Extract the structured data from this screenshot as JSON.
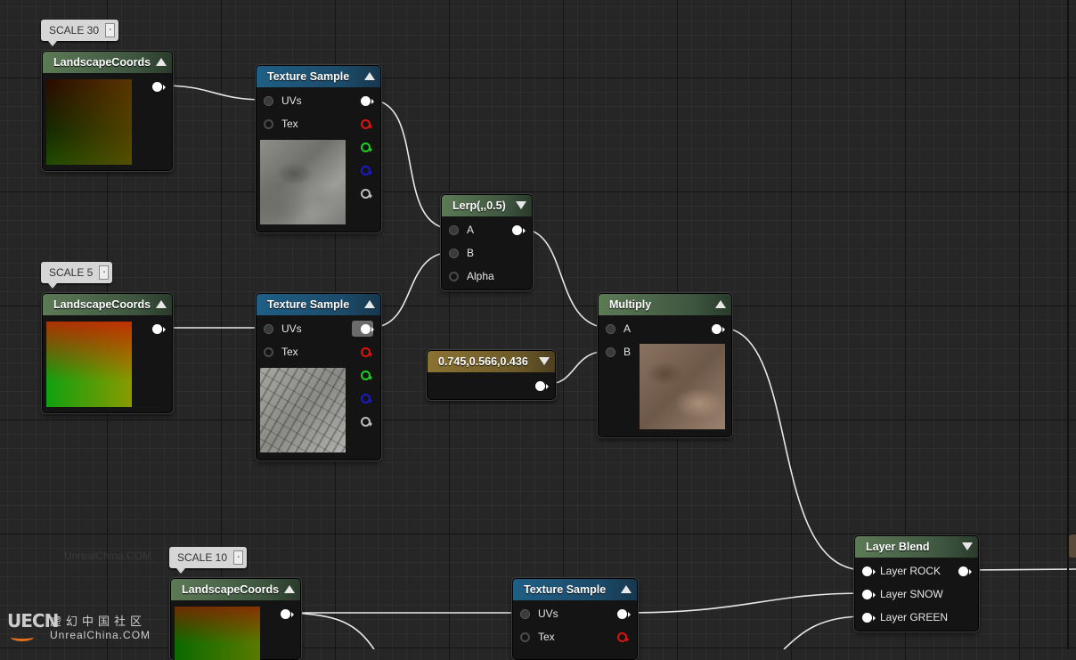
{
  "comments": {
    "scale30": "SCALE 30",
    "scale5": "SCALE 5",
    "scale10": "SCALE 10"
  },
  "nodes": {
    "coords1": {
      "title": "LandscapeCoords"
    },
    "coords2": {
      "title": "LandscapeCoords"
    },
    "coords3": {
      "title": "LandscapeCoords"
    },
    "tex1": {
      "title": "Texture Sample",
      "pins": [
        "UVs",
        "Tex"
      ]
    },
    "tex2": {
      "title": "Texture Sample",
      "pins": [
        "UVs",
        "Tex"
      ]
    },
    "tex3": {
      "title": "Texture Sample",
      "pins": [
        "UVs",
        "Tex"
      ]
    },
    "lerp": {
      "title": "Lerp(,,0.5)",
      "pins": [
        "A",
        "B",
        "Alpha"
      ]
    },
    "multiply": {
      "title": "Multiply",
      "pins": [
        "A",
        "B"
      ]
    },
    "constant": {
      "title": "0.745,0.566,0.436"
    },
    "layerblend": {
      "title": "Layer Blend",
      "pins": [
        "Layer ROCK",
        "Layer SNOW",
        "Layer GREEN"
      ]
    }
  },
  "branding": {
    "logo": "UECN",
    "chinese": "虚幻中国社区",
    "english": "UnrealChina.COM",
    "watermark": "UnrealChina.COM"
  },
  "colors": {
    "header_green": "#4a6a48",
    "header_blue": "#1e5878",
    "header_gold": "#7a6630",
    "pin_red": "#e01010",
    "pin_green": "#1bd11b",
    "pin_blue": "#1a1acc"
  }
}
